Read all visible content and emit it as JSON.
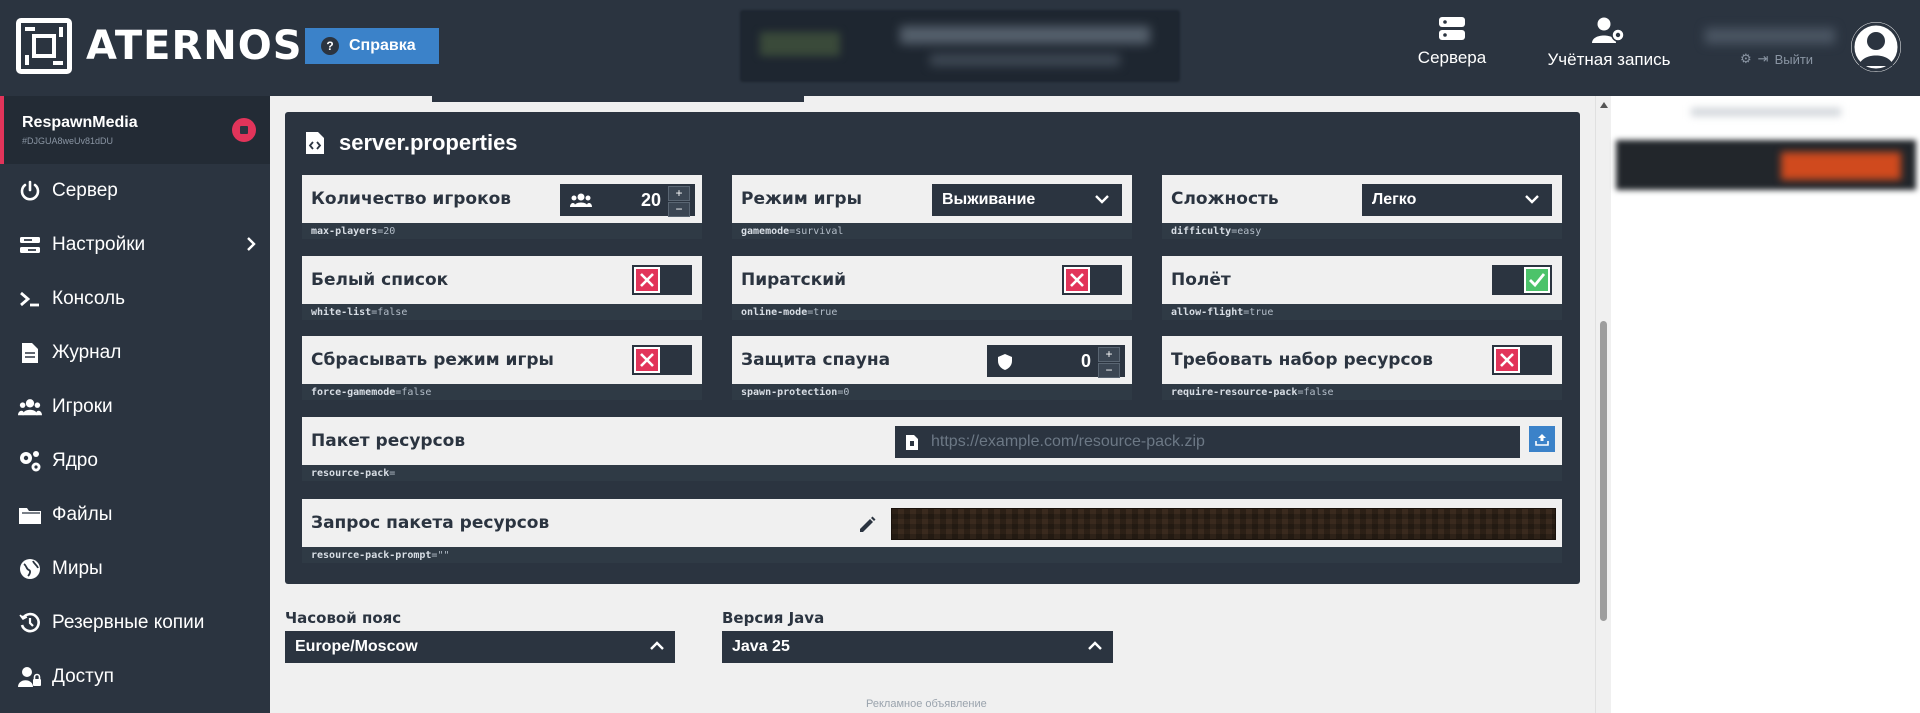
{
  "brand": {
    "name": "ATERNOS"
  },
  "header": {
    "help_label": "Справка",
    "nav": [
      {
        "label": "Сервера",
        "icon": "servers-icon"
      },
      {
        "label": "Учётная запись",
        "icon": "account-settings-icon"
      }
    ],
    "logout_label": "Выйти"
  },
  "sidebar": {
    "server_name": "RespawnMedia",
    "server_id": "#DJGUA8weUv81dDU",
    "items": [
      {
        "label": "Сервер",
        "icon": "power-icon"
      },
      {
        "label": "Настройки",
        "icon": "settings-sliders-icon"
      },
      {
        "label": "Консоль",
        "icon": "terminal-icon"
      },
      {
        "label": "Журнал",
        "icon": "log-file-icon"
      },
      {
        "label": "Игроки",
        "icon": "players-icon"
      },
      {
        "label": "Ядро",
        "icon": "software-cogs-icon"
      },
      {
        "label": "Файлы",
        "icon": "folder-icon"
      },
      {
        "label": "Миры",
        "icon": "globe-icon"
      },
      {
        "label": "Резервные копии",
        "icon": "history-icon"
      },
      {
        "label": "Доступ",
        "icon": "user-lock-icon"
      }
    ]
  },
  "properties": {
    "title": "server.properties",
    "max_players": {
      "label": "Количество игроков",
      "value": "20",
      "key_name": "max-players",
      "key_value": "=20"
    },
    "gamemode": {
      "label": "Режим игры",
      "selected": "Выживание",
      "key_name": "gamemode",
      "key_value": "=survival"
    },
    "difficulty": {
      "label": "Сложность",
      "selected": "Легко",
      "key_name": "difficulty",
      "key_value": "=easy"
    },
    "white_list": {
      "label": "Белый список",
      "state": "off",
      "key_name": "white-list",
      "key_value": "=false"
    },
    "online_mode": {
      "label": "Пиратский",
      "state": "off",
      "key_name": "online-mode",
      "key_value": "=true"
    },
    "allow_flight": {
      "label": "Полёт",
      "state": "on",
      "key_name": "allow-flight",
      "key_value": "=true"
    },
    "force_gamemode": {
      "label": "Сбрасывать режим игры",
      "state": "off",
      "key_name": "force-gamemode",
      "key_value": "=false"
    },
    "spawn_protection": {
      "label": "Защита спауна",
      "value": "0",
      "key_name": "spawn-protection",
      "key_value": "=0"
    },
    "require_resource_pack": {
      "label": "Требовать набор ресурсов",
      "state": "off",
      "key_name": "require-resource-pack",
      "key_value": "=false"
    },
    "resource_pack": {
      "label": "Пакет ресурсов",
      "placeholder": "https://example.com/resource-pack.zip",
      "key_name": "resource-pack",
      "key_value": "="
    },
    "resource_pack_prompt": {
      "label": "Запрос пакета ресурсов",
      "key_name": "resource-pack-prompt",
      "key_value": "=\"\""
    }
  },
  "timezone": {
    "label": "Часовой пояс",
    "selected": "Europe/Moscow"
  },
  "java": {
    "label": "Версия Java",
    "selected": "Java 25"
  },
  "ad_label": "Рекламное объявление",
  "colors": {
    "bg_dark": "#2b3440",
    "accent_red": "#e2345a",
    "accent_green": "#4cc36a",
    "accent_blue": "#3b82c9"
  }
}
